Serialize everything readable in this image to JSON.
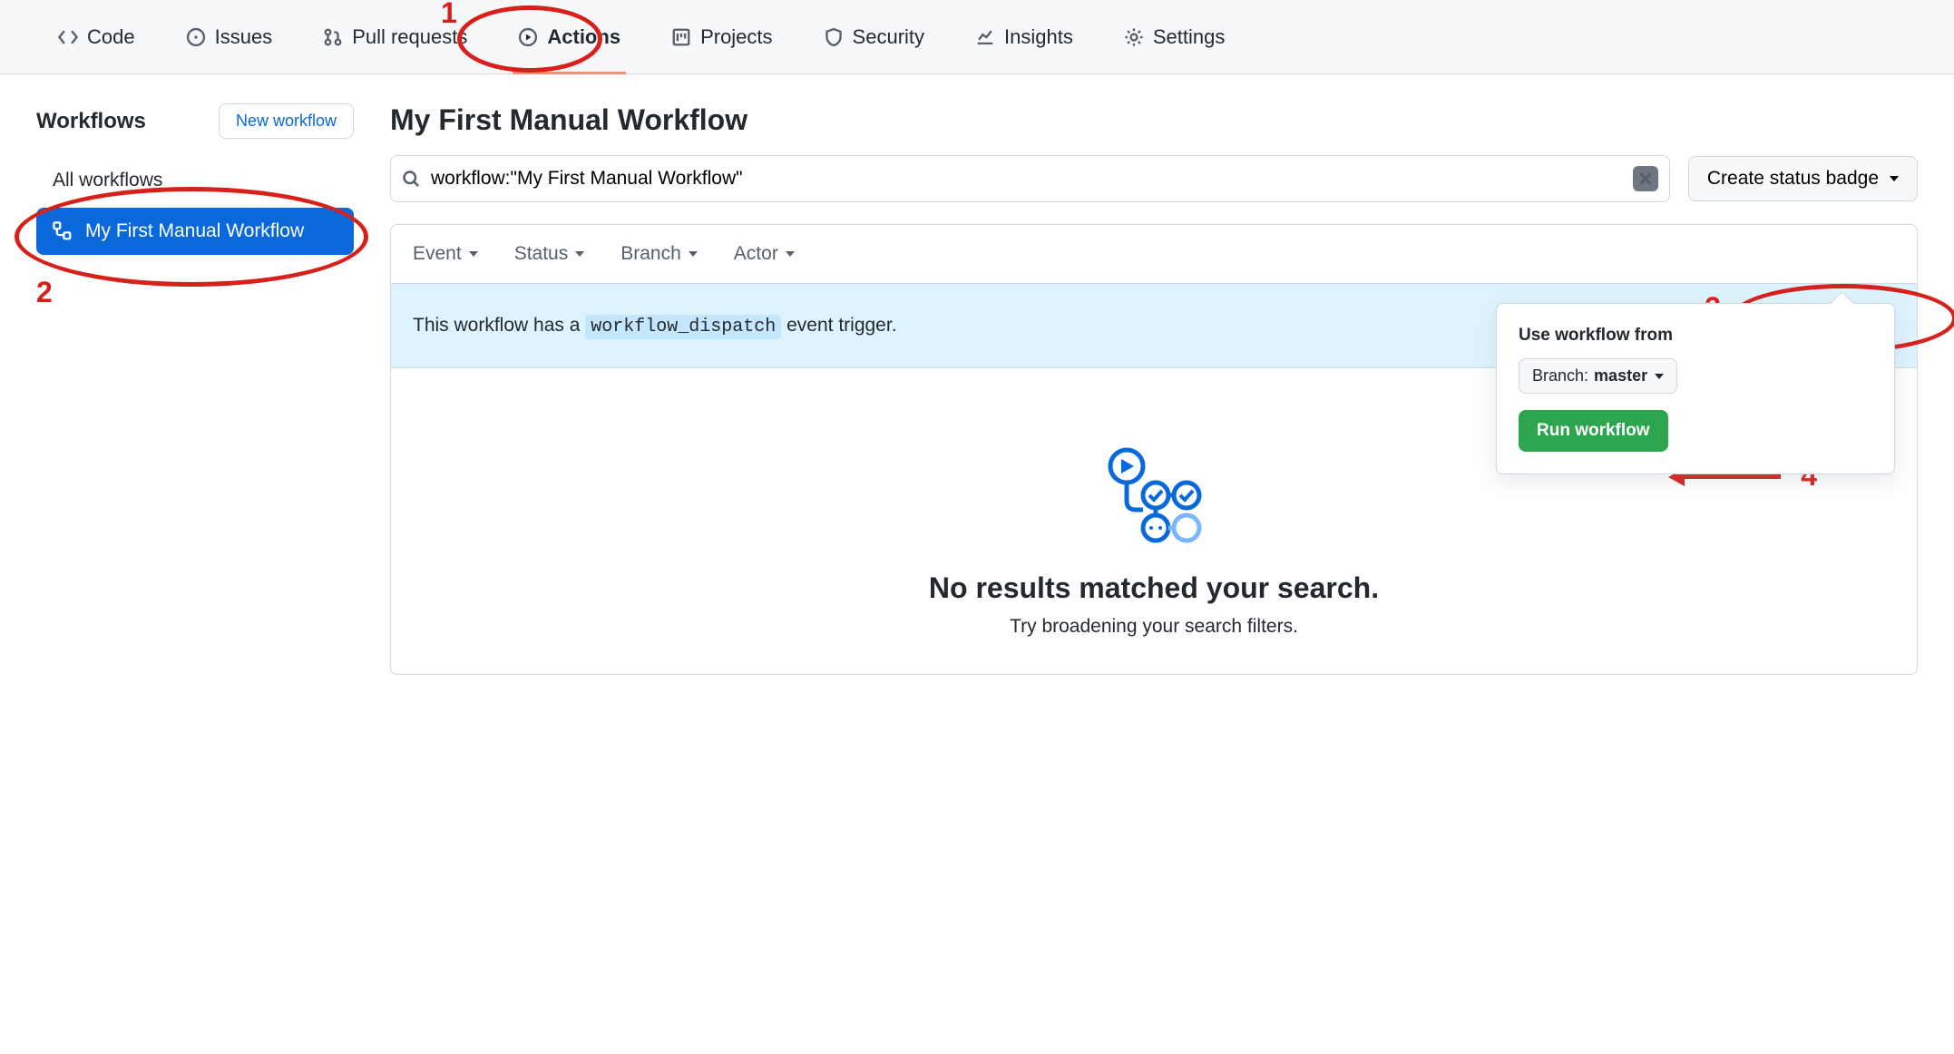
{
  "nav": {
    "code": "Code",
    "issues": "Issues",
    "pulls": "Pull requests",
    "actions": "Actions",
    "projects": "Projects",
    "security": "Security",
    "insights": "Insights",
    "settings": "Settings"
  },
  "sidebar": {
    "heading": "Workflows",
    "new_btn": "New workflow",
    "all": "All workflows",
    "active_item": "My First Manual Workflow"
  },
  "page": {
    "title": "My First Manual Workflow",
    "search_value": "workflow:\"My First Manual Workflow\"",
    "status_badge_btn": "Create status badge"
  },
  "filters": {
    "event": "Event",
    "status": "Status",
    "branch": "Branch",
    "actor": "Actor"
  },
  "dispatch": {
    "prefix": "This workflow has a ",
    "code": "workflow_dispatch",
    "suffix": " event trigger.",
    "run_btn": "Run workflow"
  },
  "popover": {
    "heading": "Use workflow from",
    "branch_label": "Branch: ",
    "branch_value": "master",
    "submit": "Run workflow"
  },
  "empty": {
    "title": "No results matched your search.",
    "sub": "Try broadening your search filters."
  },
  "annotations": {
    "n1": "1",
    "n2": "2",
    "n3": "3",
    "n4": "4"
  }
}
